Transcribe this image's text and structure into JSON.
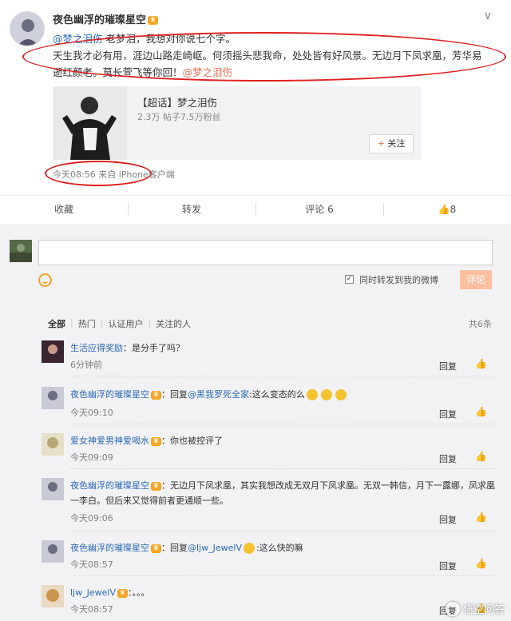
{
  "post": {
    "author": "夜色幽浮的璀璨星空",
    "mention_line_prefix": "@梦之泪伤",
    "mention_line_text": " 老梦泪，我想对你说七个字。",
    "body_text": "天生我才必有用，涯边山路走崎岖。何须摇头悲我命，处处皆有好风景。无边月下凤求凰，芳华易逝红颜老。莫长萱飞等你回！",
    "body_mention": "@梦之泪伤",
    "embed": {
      "title": "【超话】梦之泪伤",
      "stats": "2.3万 帖子7.5万粉丝",
      "follow_label": "关注",
      "follow_plus": "+"
    },
    "meta": "今天08:56 来自 iPhone客户端",
    "actions": {
      "favorite": "收藏",
      "repost": "转发",
      "comment": "评论 6",
      "like": "8"
    }
  },
  "composer": {
    "input_value": "",
    "checkbox_label": "同时转发到我的微博",
    "submit_label": "评论"
  },
  "filters": {
    "items": [
      "全部",
      "热门",
      "认证用户",
      "关注的人"
    ],
    "total": "共6条"
  },
  "comments": [
    {
      "name": "生活应得奖励",
      "text": "：是分手了吗？",
      "time": "6分钟前",
      "reply": "回复"
    },
    {
      "name": "夜色幽浮的璀璨星空",
      "text_a": "：回复",
      "mention": "@黑我罗死全家",
      "text_b": ":这么变态的么",
      "time": "今天09:10",
      "reply": "回复"
    },
    {
      "name": "爱女神爱男神爱喝水",
      "text": "：你也被控评了",
      "time": "今天09:09",
      "reply": "回复"
    },
    {
      "name": "夜色幽浮的璀璨星空",
      "text": "：无边月下凤求凰，其实我想改成无双月下凤求凰。无双一韩信，月下一露娜，凤求凰一李白。但后来又觉得前者更通顺一些。",
      "time": "今天09:06",
      "reply": "回复"
    },
    {
      "name": "夜色幽浮的璀璨星空",
      "text_a": "：回复",
      "mention": "@ljw_JewelV",
      "text_b": ":这么快的嘛",
      "time": "今天08:57",
      "reply": "回复"
    },
    {
      "name": "ljw_JewelV",
      "text": "：。。。",
      "time": "今天08:57",
      "reply": "回复"
    }
  ],
  "watermark": "悟空问答",
  "colors": {
    "link_orange": "#eb7350",
    "name_blue": "#2a6bb5",
    "annotation_red": "#e02020",
    "submit_disabled": "#ffc09f"
  }
}
